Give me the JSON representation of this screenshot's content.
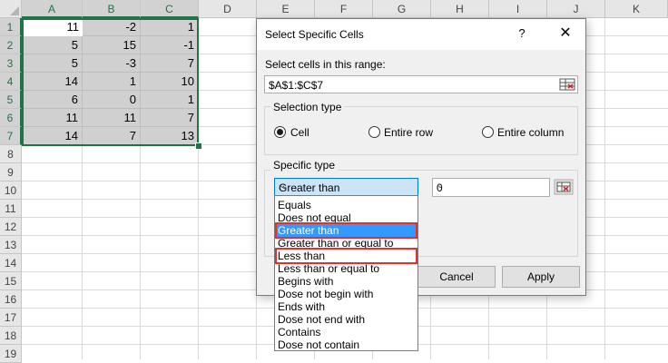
{
  "sheet": {
    "columns": [
      "A",
      "B",
      "C",
      "D",
      "E",
      "F",
      "G",
      "H",
      "I",
      "J",
      "K"
    ],
    "rows": [
      "1",
      "2",
      "3",
      "4",
      "5",
      "6",
      "7",
      "8",
      "9",
      "10",
      "11",
      "12",
      "13",
      "14",
      "15",
      "16",
      "17",
      "18",
      "19"
    ],
    "data": [
      [
        "11",
        "-2",
        "1"
      ],
      [
        "5",
        "15",
        "-1"
      ],
      [
        "5",
        "-3",
        "7"
      ],
      [
        "14",
        "1",
        "10"
      ],
      [
        "6",
        "0",
        "1"
      ],
      [
        "11",
        "11",
        "7"
      ],
      [
        "14",
        "7",
        "13"
      ]
    ]
  },
  "dialog": {
    "title": "Select Specific Cells",
    "help": "?",
    "close": "✕",
    "range_label": "Select cells in this range:",
    "range_value": "$A$1:$C$7",
    "selection_type": {
      "label": "Selection type",
      "options": [
        "Cell",
        "Entire row",
        "Entire column"
      ],
      "selected": "Cell"
    },
    "specific_type": {
      "label": "Specific type",
      "condition": "Greater than",
      "value": "0"
    },
    "buttons": {
      "cancel": "Cancel",
      "apply": "Apply"
    }
  },
  "dropdown": {
    "options": [
      "Equals",
      "Does not equal",
      "Greater than",
      "Greater than or equal to",
      "Less than",
      "Less than or equal to",
      "Begins with",
      "Dose not begin with",
      "Ends with",
      "Dose not end with",
      "Contains",
      "Dose not contain"
    ],
    "selected": "Greater than",
    "highlighted": [
      "Greater than",
      "Less than"
    ]
  },
  "colors": {
    "selection": "#217346",
    "highlight_border": "#e03030",
    "selected_option": "#3399ff"
  }
}
